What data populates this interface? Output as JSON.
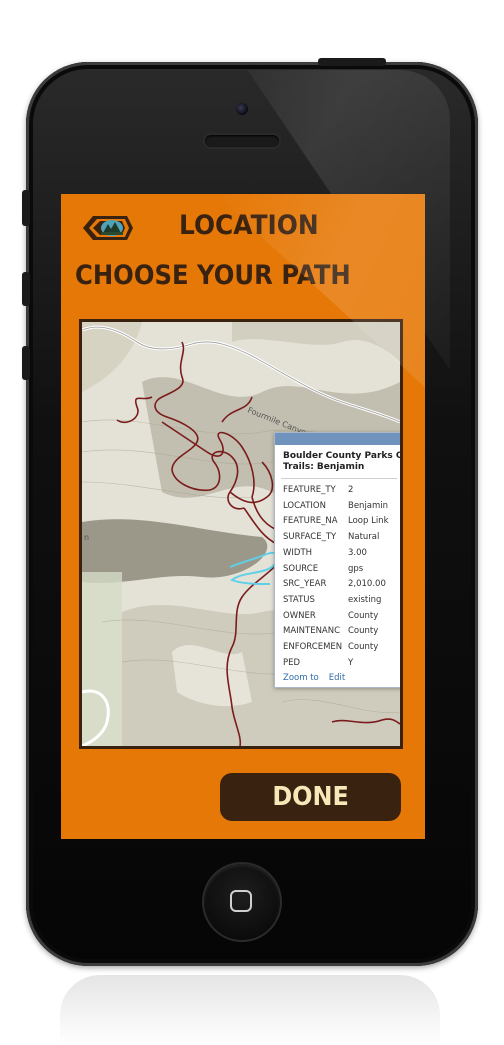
{
  "screen": {
    "title": "LOCATION",
    "subtitle": "CHOOSE YOUR PATH",
    "done_label": "DONE"
  },
  "map": {
    "road_label": "Fourmile Canyon D",
    "popup": {
      "title_line1": "Boulder County Parks Op",
      "title_line2": "Trails: Benjamin",
      "rows": [
        {
          "key": "FEATURE_TY",
          "value": "2"
        },
        {
          "key": "LOCATION",
          "value": "Benjamin"
        },
        {
          "key": "FEATURE_NA",
          "value": "Loop Link"
        },
        {
          "key": "SURFACE_TY",
          "value": "Natural"
        },
        {
          "key": "WIDTH",
          "value": "3.00"
        },
        {
          "key": "SOURCE",
          "value": "gps"
        },
        {
          "key": "SRC_YEAR",
          "value": "2,010.00"
        },
        {
          "key": "STATUS",
          "value": "existing"
        },
        {
          "key": "OWNER",
          "value": "County"
        },
        {
          "key": "MAINTENANC",
          "value": "County"
        },
        {
          "key": "ENFORCEMEN",
          "value": "County"
        },
        {
          "key": "PED",
          "value": "Y"
        }
      ],
      "zoom_link": "Zoom to",
      "edit_link": "Edit"
    }
  },
  "colors": {
    "screen_bg": "#e67807",
    "brand_dark": "#3a2210",
    "done_text": "#f6e8b8",
    "trail": "#7a1c1c",
    "highlight_trail": "#5fd0e8"
  },
  "icons": {
    "back": "back-arrow-badge-icon"
  }
}
